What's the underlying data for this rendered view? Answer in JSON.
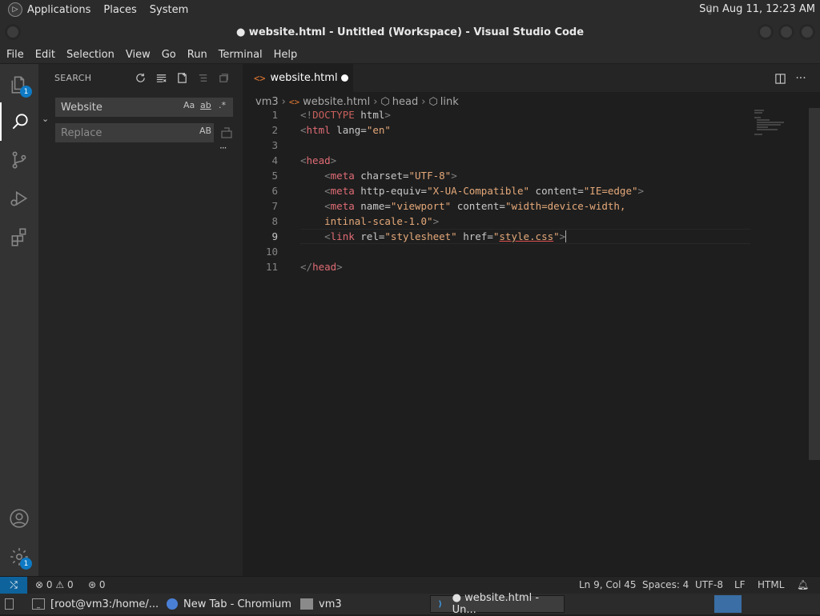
{
  "system_panel": {
    "menus": [
      "Applications",
      "Places",
      "System"
    ],
    "clock": "Sun Aug 11, 12:23 AM"
  },
  "window": {
    "title": "● website.html - Untitled (Workspace) - Visual Studio Code"
  },
  "menubar": [
    "File",
    "Edit",
    "Selection",
    "View",
    "Go",
    "Run",
    "Terminal",
    "Help"
  ],
  "activity_bar": {
    "explorer_badge": "1",
    "manage_badge": "1",
    "icons": [
      "files-icon",
      "search-icon",
      "source-control-icon",
      "run-debug-icon",
      "extensions-icon",
      "account-icon",
      "gear-icon"
    ]
  },
  "sidebar": {
    "header": "SEARCH",
    "search_value": "Website",
    "replace_placeholder": "Replace",
    "match_case": "Aa",
    "whole_word": "ab",
    "regex": ".*",
    "preserve_case": "AB"
  },
  "editor": {
    "tab_label": "website.html",
    "breadcrumb": [
      "vm3",
      "website.html",
      "head",
      "link"
    ],
    "current_line": 9,
    "line_numbers": [
      "1",
      "2",
      "3",
      "4",
      "5",
      "6",
      "7",
      "8",
      "9",
      "10",
      "11"
    ]
  },
  "status_bar": {
    "errors": "0",
    "warnings": "0",
    "ports": "0",
    "position": "Ln 9, Col 45",
    "spaces": "Spaces: 4",
    "encoding": "UTF-8",
    "eol": "LF",
    "language": "HTML"
  },
  "taskbar": {
    "items": [
      "[root@vm3:/home/...",
      "New Tab - Chromium",
      "vm3",
      "● website.html - Un..."
    ]
  },
  "colors": {
    "accent": "#0e639c",
    "badge": "#0e7ac4",
    "tag": "#e06c75",
    "string": "#e5a97a"
  }
}
